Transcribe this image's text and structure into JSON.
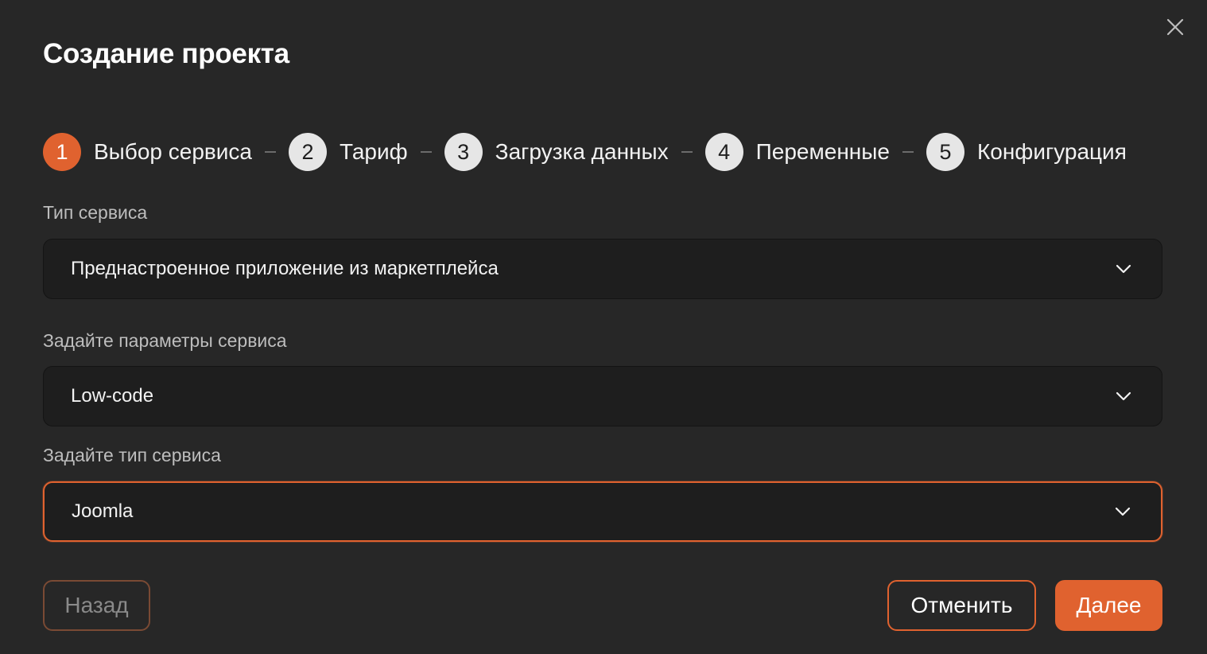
{
  "dialog": {
    "title": "Создание проекта"
  },
  "stepper": {
    "steps": [
      {
        "number": "1",
        "label": "Выбор сервиса",
        "active": true
      },
      {
        "number": "2",
        "label": "Тариф",
        "active": false
      },
      {
        "number": "3",
        "label": "Загрузка данных",
        "active": false
      },
      {
        "number": "4",
        "label": "Переменные",
        "active": false
      },
      {
        "number": "5",
        "label": "Конфигурация",
        "active": false
      }
    ]
  },
  "form": {
    "service_type": {
      "label": "Тип сервиса",
      "value": "Преднастроенное приложение из маркетплейса"
    },
    "service_params": {
      "label": "Задайте параметры сервиса",
      "value": "Low-code"
    },
    "service_kind": {
      "label": "Задайте тип сервиса",
      "value": "Joomla"
    }
  },
  "actions": {
    "back_label": "Назад",
    "cancel_label": "Отменить",
    "next_label": "Далее"
  },
  "icons": {
    "close": "close-icon",
    "dropdown": "chevron-down-icon"
  },
  "colors": {
    "accent": "#e0622f",
    "background": "#272727",
    "field_background": "#1e1e1e",
    "step_inactive": "#e6e6e6"
  }
}
